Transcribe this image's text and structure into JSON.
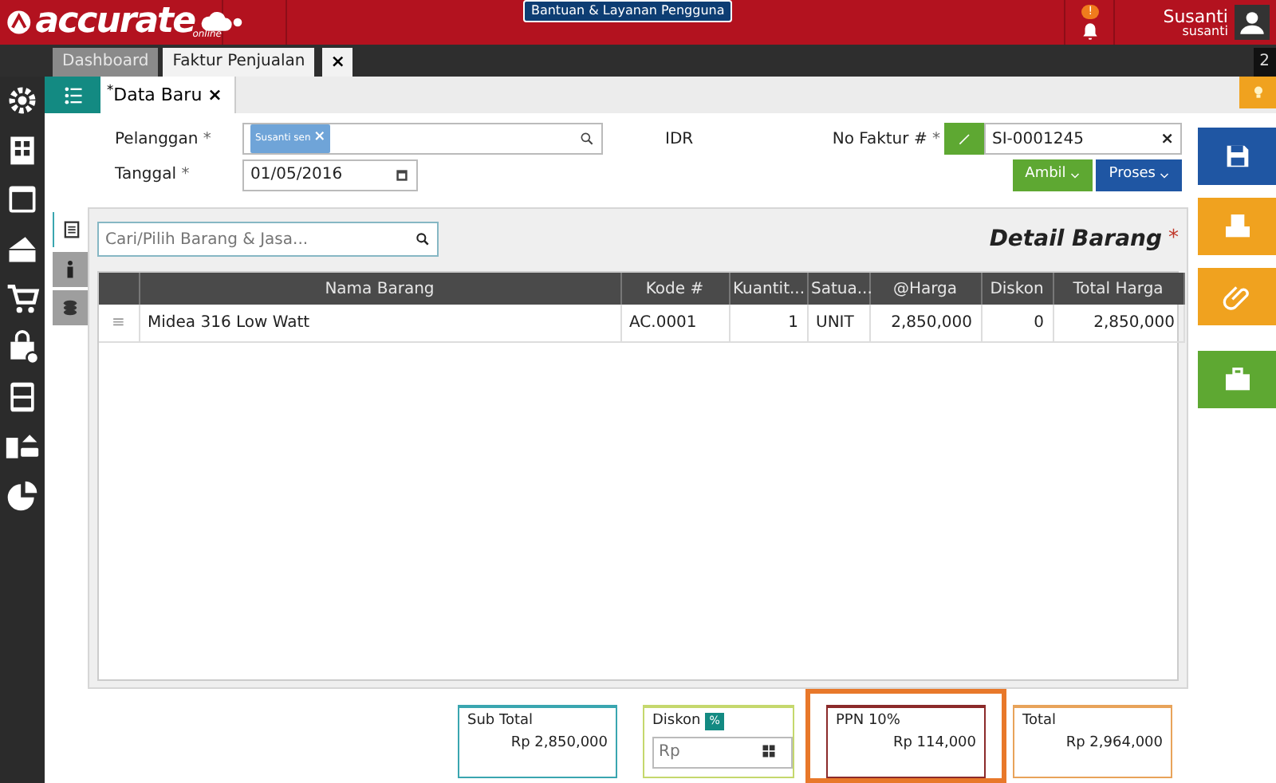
{
  "header": {
    "logo": "accurate",
    "logo_sub": "online",
    "help_button": "Bantuan & Layanan Pengguna",
    "notification_badge": "!",
    "user_name": "Susanti",
    "user_login": "susanti"
  },
  "tabs": [
    {
      "label": "Dashboard",
      "selected": false
    },
    {
      "label": "Faktur Penjualan",
      "selected": true
    }
  ],
  "tab_close": "×",
  "tab_count": "2",
  "doc_tabs": [
    {
      "label": "Data Baru",
      "marker": "*",
      "close": "×",
      "selected": true
    }
  ],
  "form": {
    "customer_label": "Pelanggan",
    "customer_tag": "Susanti sen",
    "customer_tag_remove": "×",
    "currency": "IDR",
    "date_label": "Tanggal",
    "date_value": "01/05/2016",
    "required_mark": "*",
    "invoice_label": "No Faktur #",
    "invoice_value": "SI-0001245",
    "invoice_clear": "×",
    "buttons": [
      {
        "label": "Ambil",
        "kind": "success"
      },
      {
        "label": "Proses",
        "kind": "primary"
      }
    ]
  },
  "side_tabs": [
    {
      "kind": "list",
      "selected": true
    },
    {
      "kind": "info",
      "selected": false
    },
    {
      "kind": "coins",
      "selected": false
    }
  ],
  "item_search": {
    "placeholder": "Cari/Pilih Barang & Jasa..."
  },
  "section_title": "Detail Barang",
  "section_required": "*",
  "table": {
    "columns": [
      "",
      "Nama Barang",
      "Kode #",
      "Kuantit...",
      "Satua...",
      "@Harga",
      "Diskon",
      "Total Harga"
    ],
    "rows": [
      {
        "cells": [
          "≡",
          "Midea 316 Low Watt",
          "AC.0001",
          "1",
          "UNIT",
          "2,850,000",
          "0",
          "2,850,000"
        ]
      }
    ]
  },
  "summary": [
    {
      "kind": "value",
      "label": "Sub Total",
      "value": "Rp 2,850,000",
      "color": "#3aa6b0",
      "highlighted": false
    },
    {
      "kind": "input",
      "label": "Diskon",
      "toggle": "%",
      "placeholder": "Rp",
      "color": "#c5d86d",
      "highlighted": false
    },
    {
      "kind": "value",
      "label": "PPN 10%",
      "value": "Rp 114,000",
      "color": "#8b2a2a",
      "highlighted": true
    },
    {
      "kind": "value",
      "label": "Total",
      "value": "Rp 2,964,000",
      "color": "#e8a35a",
      "highlighted": false
    }
  ]
}
